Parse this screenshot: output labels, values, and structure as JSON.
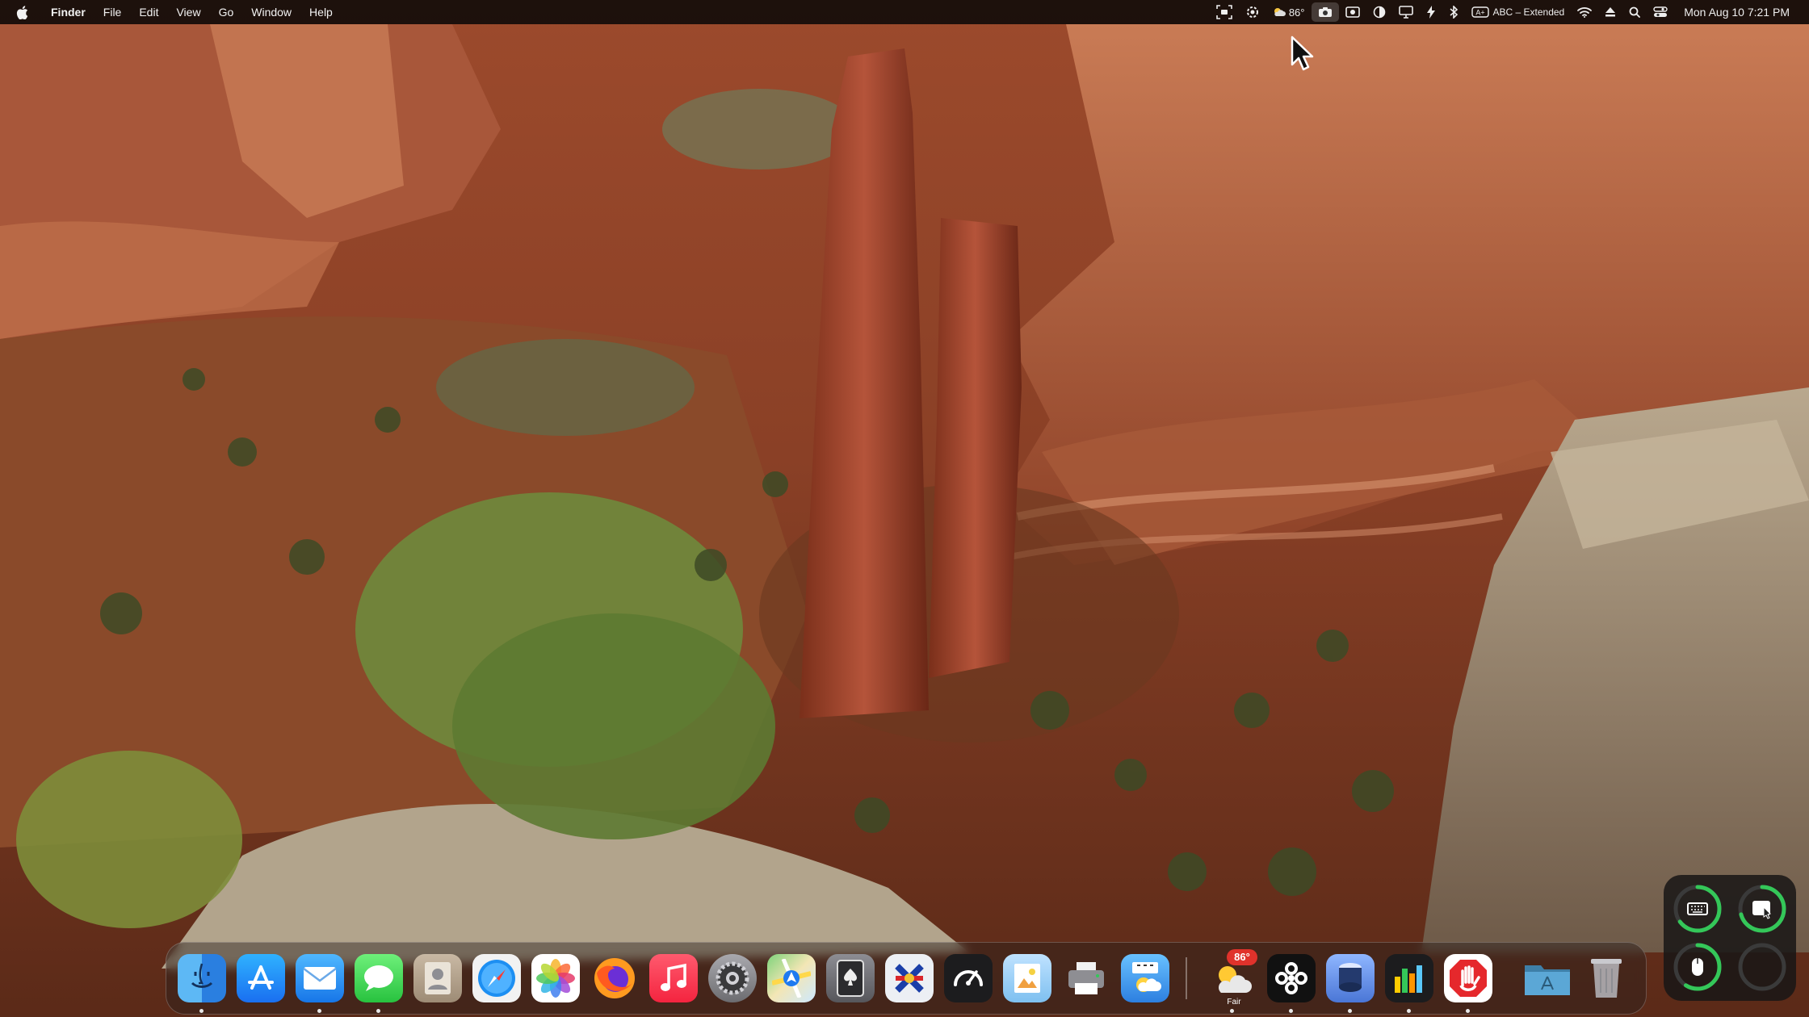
{
  "menubar": {
    "app_name": "Finder",
    "menus": [
      "File",
      "Edit",
      "View",
      "Go",
      "Window",
      "Help"
    ],
    "weather_temp": "86°",
    "input_source": "ABC – Extended",
    "clock": "Mon Aug 10  7:21 PM"
  },
  "dock": {
    "apps": [
      {
        "name": "Finder",
        "icon": "finder-icon",
        "running": true
      },
      {
        "name": "App Store",
        "icon": "app-store-icon",
        "running": false
      },
      {
        "name": "Mail",
        "icon": "mail-icon",
        "running": true
      },
      {
        "name": "Messages",
        "icon": "messages-icon",
        "running": true
      },
      {
        "name": "Contacts",
        "icon": "contacts-icon",
        "running": false
      },
      {
        "name": "Safari",
        "icon": "safari-icon",
        "running": false
      },
      {
        "name": "Photos",
        "icon": "photos-icon",
        "running": false
      },
      {
        "name": "Firefox",
        "icon": "firefox-icon",
        "running": false
      },
      {
        "name": "Music",
        "icon": "music-icon",
        "running": false
      },
      {
        "name": "System Settings",
        "icon": "system-settings-icon",
        "running": false
      },
      {
        "name": "Maps",
        "icon": "maps-icon",
        "running": false
      },
      {
        "name": "Solitaire",
        "icon": "spade-card-icon",
        "running": false
      },
      {
        "name": "Network Utility",
        "icon": "network-tool-icon",
        "running": false
      },
      {
        "name": "Activity Gauge",
        "icon": "speedometer-icon",
        "running": false
      },
      {
        "name": "Preview",
        "icon": "preview-icon",
        "running": false
      },
      {
        "name": "Printer",
        "icon": "printer-icon",
        "running": false
      },
      {
        "name": "Weather Clock",
        "icon": "weather-clock-icon",
        "running": false
      },
      {
        "name": "Weather",
        "icon": "weather-icon",
        "running": true
      },
      {
        "name": "Shortcuts Hub",
        "icon": "flower-node-icon",
        "running": true
      },
      {
        "name": "Cylinder App",
        "icon": "cylinder-icon",
        "running": true
      },
      {
        "name": "Charts",
        "icon": "bar-chart-icon",
        "running": true
      },
      {
        "name": "Stop Hand",
        "icon": "stop-hand-icon",
        "running": true
      }
    ],
    "weather_badge": "86°",
    "weather_label": "Fair",
    "folder": "applications-folder-icon",
    "trash": "trash-icon"
  },
  "colors": {
    "menubar_bg": "#120c0a",
    "ring_green": "#34c759",
    "badge_red": "#e0322b"
  }
}
